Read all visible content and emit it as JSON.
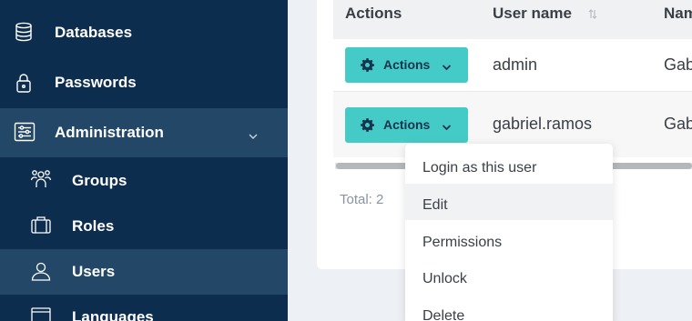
{
  "sidebar": {
    "items": [
      {
        "label": "Databases",
        "icon": "database-icon"
      },
      {
        "label": "Passwords",
        "icon": "lock-icon"
      },
      {
        "label": "Administration",
        "icon": "sliders-icon",
        "expanded": true
      }
    ],
    "subitems": [
      {
        "label": "Groups",
        "icon": "groups-icon"
      },
      {
        "label": "Roles",
        "icon": "briefcase-icon"
      },
      {
        "label": "Users",
        "icon": "user-icon",
        "active": true
      },
      {
        "label": "Languages",
        "icon": "languages-icon"
      }
    ]
  },
  "table": {
    "headers": {
      "actions": "Actions",
      "user_name": "User name",
      "name": "Nam"
    },
    "rows": [
      {
        "action_label": "Actions",
        "user_name": "admin",
        "name": "Gab"
      },
      {
        "action_label": "Actions",
        "user_name": "gabriel.ramos",
        "name": "Gab"
      }
    ],
    "total": "Total: 2"
  },
  "dropdown": {
    "items": [
      "Login as this user",
      "Edit",
      "Permissions",
      "Unlock",
      "Delete"
    ],
    "hovered": "Edit"
  },
  "colors": {
    "sidebar_bg": "#0c2d4d",
    "sidebar_active": "#224767",
    "accent": "#45cbc7"
  }
}
